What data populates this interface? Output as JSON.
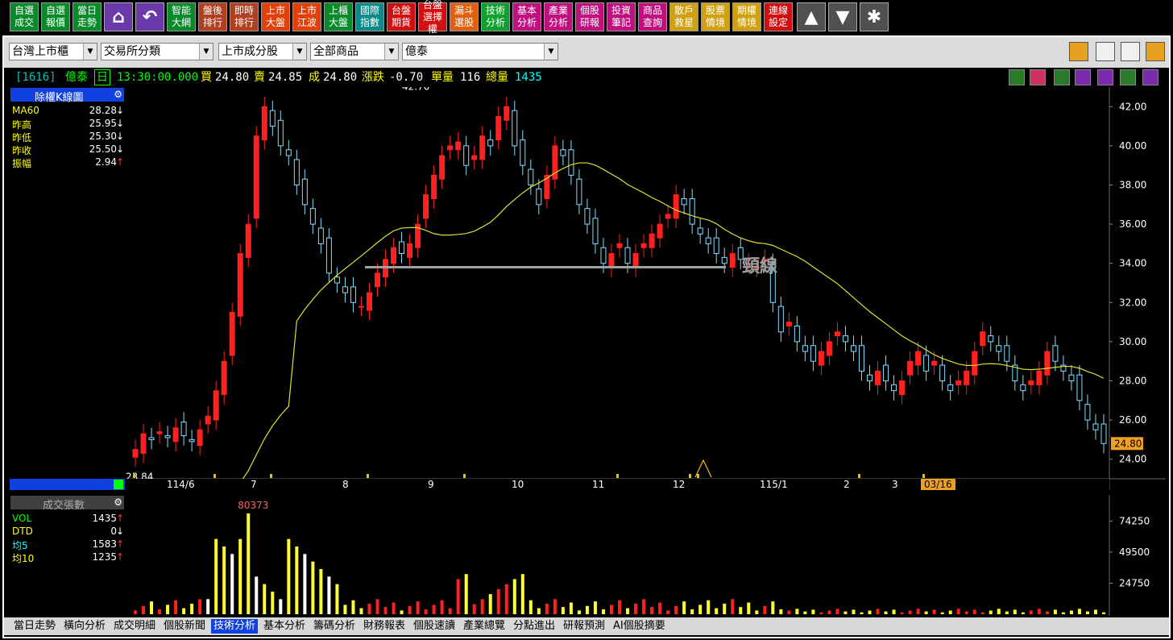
{
  "toolbar": {
    "buttons": [
      {
        "label": "自選\n成交",
        "color": "#0a8a2a"
      },
      {
        "label": "自選\n報價",
        "color": "#0a8a2a"
      },
      {
        "label": "當日\n走勢",
        "color": "#0a8a2a"
      },
      {
        "label": "智能\n大網",
        "color": "#0a8a2a"
      },
      {
        "label": "盤後\n排行",
        "color": "#b04020"
      },
      {
        "label": "即時\n排行",
        "color": "#b04020"
      },
      {
        "label": "上市\n大盤",
        "color": "#e0400a"
      },
      {
        "label": "上市\n江波",
        "color": "#e0400a"
      },
      {
        "label": "上櫃\n大盤",
        "color": "#0a8a2a"
      },
      {
        "label": "國際\n指數",
        "color": "#0a8a8a"
      },
      {
        "label": "台盤\n期貨",
        "color": "#d01010"
      },
      {
        "label": "台盤\n選擇權",
        "color": "#d01010"
      },
      {
        "label": "漏斗\n選股",
        "color": "#e06010"
      },
      {
        "label": "技術\n分析",
        "color": "#10a030"
      },
      {
        "label": "基本\n分析",
        "color": "#c01080"
      },
      {
        "label": "產業\n分析",
        "color": "#c01080"
      },
      {
        "label": "個股\n研報",
        "color": "#c01080"
      },
      {
        "label": "投資\n筆記",
        "color": "#c01080"
      },
      {
        "label": "商品\n查詢",
        "color": "#c01080"
      },
      {
        "label": "散戶\n救星",
        "color": "#d0a010"
      },
      {
        "label": "股票\n情境",
        "color": "#d0a010"
      },
      {
        "label": "期權\n情境",
        "color": "#d0a010"
      },
      {
        "label": "連線\n設定",
        "color": "#d01010"
      }
    ],
    "icons": [
      "home-icon",
      "undo-icon",
      "arrow-up-icon",
      "arrow-down-icon",
      "asterisk-icon"
    ]
  },
  "filters": {
    "market": "台灣上市櫃",
    "category": "交易所分類",
    "subcategory": "上市成分股",
    "products": "全部商品",
    "stock": "億泰"
  },
  "quote": {
    "code": "[1616]",
    "name": "億泰",
    "period": "日",
    "time": "13:30:00.000",
    "buy_label": "買",
    "buy": "24.80",
    "sell_label": "賣",
    "sell": "24.85",
    "deal_label": "成",
    "deal": "24.80",
    "change_label": "漲跌",
    "change": "-0.70",
    "unit_vol_label": "單量",
    "unit_vol": "116",
    "total_vol_label": "總量",
    "total_vol": "1435"
  },
  "kpanel": {
    "title": "除權K線圖",
    "rows": [
      {
        "name": "MA60",
        "value": "28.28",
        "arrow": "↓",
        "color": "#ffff00"
      },
      {
        "name": "昨高",
        "value": "25.95",
        "arrow": "↓",
        "color": "#ffff00"
      },
      {
        "name": "昨低",
        "value": "25.30",
        "arrow": "↓",
        "color": "#ffff00"
      },
      {
        "name": "昨收",
        "value": "25.50",
        "arrow": "↓",
        "color": "#ffff00"
      },
      {
        "name": "振幅",
        "value": "2.94",
        "arrow": "↑",
        "color": "#ffff00"
      }
    ],
    "high_label": "42.70",
    "low_label": "23.84",
    "neckline_label": "頸線",
    "last_price": "24.80",
    "last_date": "03/16",
    "y_ticks": [
      "42.00",
      "40.00",
      "38.00",
      "36.00",
      "34.00",
      "32.00",
      "30.00",
      "28.00",
      "26.00",
      "24.00"
    ],
    "x_ticks": [
      "114/6",
      "7",
      "8",
      "9",
      "10",
      "11",
      "12",
      "115/1",
      "2",
      "3"
    ]
  },
  "vpanel": {
    "title": "成交張數",
    "rows": [
      {
        "name": "VOL",
        "value": "1435",
        "arrow": "↑",
        "color": "#00ff00"
      },
      {
        "name": "DTD",
        "value": "0",
        "arrow": "↓",
        "color": "#ffff00"
      },
      {
        "name": "均5",
        "value": "1583",
        "arrow": "↑",
        "color": "#00ffff"
      },
      {
        "name": "均10",
        "value": "1235",
        "arrow": "↑",
        "color": "#ffff00"
      }
    ],
    "peak_label": "80373",
    "y_ticks": [
      "74250",
      "49500",
      "24750"
    ]
  },
  "tabs": [
    "當日走勢",
    "橫向分析",
    "成交明細",
    "個股新聞",
    "技術分析",
    "基本分析",
    "籌碼分析",
    "財務報表",
    "個股速讀",
    "產業總覽",
    "分點進出",
    "研報預測",
    "AI個股摘要"
  ],
  "active_tab": "技術分析",
  "chart_data": {
    "type": "candlestick",
    "ylim": [
      23,
      43
    ],
    "x_labels": [
      "114/6",
      "7",
      "8",
      "9",
      "10",
      "11",
      "12",
      "115/1",
      "2",
      "3"
    ],
    "close_series": [
      24.5,
      25.3,
      25.0,
      25.4,
      25.1,
      25.6,
      25.2,
      24.9,
      25.5,
      26.2,
      27.5,
      29.0,
      31.5,
      34.5,
      36.0,
      40.5,
      42.0,
      41.0,
      40.0,
      39.5,
      38.0,
      37.0,
      36.0,
      35.0,
      33.5,
      33.0,
      32.5,
      32.0,
      31.8,
      32.5,
      33.5,
      34.2,
      34.8,
      34.5,
      35.0,
      36.0,
      37.5,
      38.5,
      39.5,
      40.0,
      40.2,
      39.0,
      39.5,
      40.5,
      40.0,
      41.5,
      42.0,
      40.0,
      39.0,
      38.0,
      37.0,
      38.5,
      40.0,
      39.5,
      38.5,
      37.0,
      36.0,
      35.0,
      34.0,
      34.5,
      35.0,
      34.0,
      34.5,
      35.0,
      35.5,
      36.0,
      36.5,
      37.5,
      37.0,
      36.0,
      35.5,
      35.0,
      34.5,
      34.0,
      34.5,
      34.2,
      34.0,
      33.8,
      34.2,
      32.0,
      30.5,
      31.0,
      30.0,
      29.5,
      29.0,
      29.5,
      30.0,
      30.5,
      30.0,
      29.5,
      28.5,
      28.0,
      28.5,
      28.0,
      27.5,
      28.0,
      29.0,
      29.5,
      28.5,
      29.0,
      28.0,
      27.5,
      28.0,
      28.5,
      29.5,
      30.5,
      30.0,
      29.5,
      29.0,
      28.0,
      27.5,
      28.0,
      28.5,
      29.5,
      29.0,
      28.5,
      28.0,
      27.0,
      26.0,
      25.5,
      24.8
    ]
  }
}
